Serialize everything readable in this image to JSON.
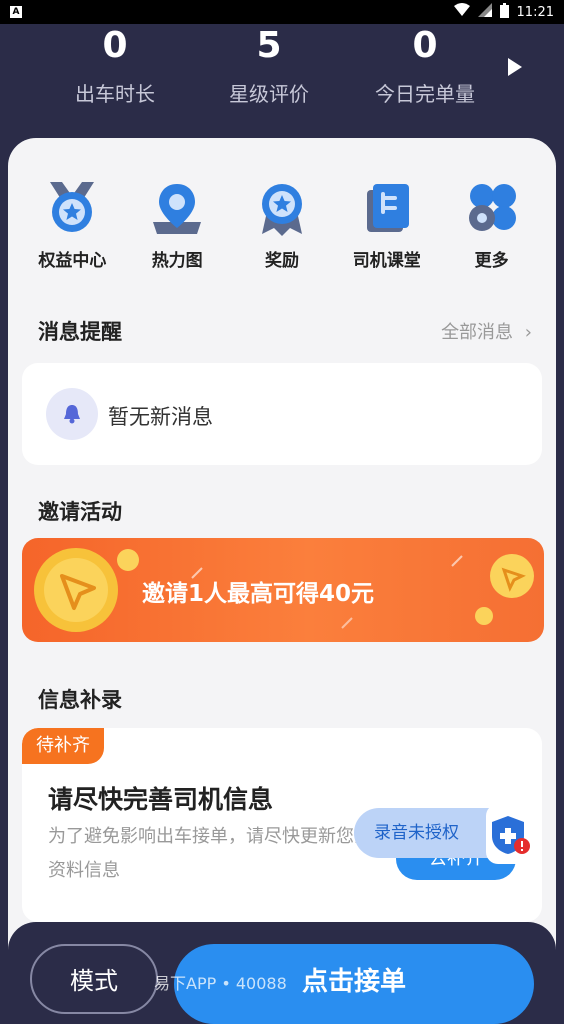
{
  "status_bar": {
    "time": "11:21",
    "left_badge": "A"
  },
  "stats": [
    {
      "value": "0",
      "label": "出车时长"
    },
    {
      "value": "5",
      "label": "星级评价"
    },
    {
      "value": "0",
      "label": "今日完单量"
    }
  ],
  "quick_actions": [
    {
      "label": "权益中心",
      "icon": "badge-star-icon"
    },
    {
      "label": "热力图",
      "icon": "map-pin-icon"
    },
    {
      "label": "奖励",
      "icon": "ribbon-medal-icon"
    },
    {
      "label": "司机课堂",
      "icon": "book-icon"
    },
    {
      "label": "更多",
      "icon": "grid-circles-icon"
    }
  ],
  "messages": {
    "title": "消息提醒",
    "all_link": "全部消息",
    "empty_text": "暂无新消息"
  },
  "invite": {
    "title": "邀请活动",
    "banner_text": "邀请1人最高可得40元"
  },
  "info": {
    "title": "信息补录",
    "tag": "待补齐",
    "card_title": "请尽快完善司机信息",
    "card_desc": "为了避免影响出车接单，请尽快更新您的资料信息",
    "button": "去补齐"
  },
  "recording": {
    "label": "录音未授权"
  },
  "bottom": {
    "mode_button": "模式",
    "accept_button": "点击接单",
    "ticker": "易下APP • 40088"
  },
  "colors": {
    "accent": "#2a8ef0",
    "orange": "#f6731f",
    "dark": "#2b2c48"
  }
}
